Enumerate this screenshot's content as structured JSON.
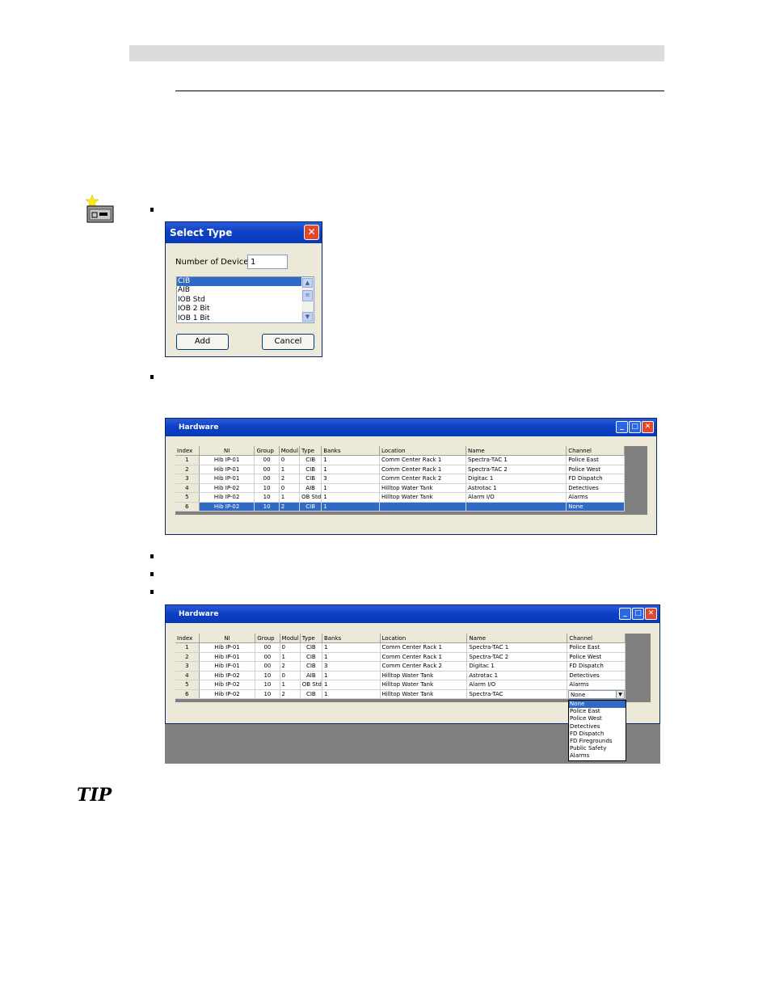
{
  "select_dialog": {
    "title": "Select Type",
    "close_glyph": "✕",
    "num_devices_label": "Number of Devices:",
    "num_devices_value": "1",
    "types": [
      "CIB",
      "AIB",
      "IOB Std",
      "IOB 2 Bit",
      "IOB 1 Bit"
    ],
    "selected_type": "CIB",
    "add_label": "Add",
    "cancel_label": "Cancel"
  },
  "hardware1": {
    "title": "Hardware",
    "columns": [
      "Index",
      "NI",
      "Group",
      "Modul",
      "Type",
      "Banks",
      "Location",
      "Name",
      "Channel"
    ],
    "rows": [
      [
        "1",
        "Hib IP-01",
        "00",
        "0",
        "CIB",
        "1",
        "Comm Center Rack 1",
        "Spectra-TAC 1",
        "Police East"
      ],
      [
        "2",
        "Hib IP-01",
        "00",
        "1",
        "CIB",
        "1",
        "Comm Center Rack 1",
        "Spectra-TAC 2",
        "Police West"
      ],
      [
        "3",
        "Hib IP-01",
        "00",
        "2",
        "CIB",
        "3",
        "Comm Center Rack 2",
        "Digitac 1",
        "FD Dispatch"
      ],
      [
        "4",
        "Hib IP-02",
        "10",
        "0",
        "AIB",
        "1",
        "Hilltop Water Tank",
        "Astrotac 1",
        "Detectives"
      ],
      [
        "5",
        "Hib IP-02",
        "10",
        "1",
        "OB Std",
        "1",
        "Hilltop Water Tank",
        "Alarm I/O",
        "Alarms"
      ],
      [
        "6",
        "Hib IP-02",
        "10",
        "2",
        "CIB",
        "1",
        "",
        "",
        "None"
      ]
    ]
  },
  "hardware2": {
    "title": "Hardware",
    "columns": [
      "Index",
      "NI",
      "Group",
      "Modul",
      "Type",
      "Banks",
      "Location",
      "Name",
      "Channel"
    ],
    "rows": [
      [
        "1",
        "Hib IP-01",
        "00",
        "0",
        "CIB",
        "1",
        "Comm Center Rack 1",
        "Spectra-TAC 1",
        "Police East"
      ],
      [
        "2",
        "Hib IP-01",
        "00",
        "1",
        "CIB",
        "1",
        "Comm Center Rack 1",
        "Spectra-TAC 2",
        "Police West"
      ],
      [
        "3",
        "Hib IP-01",
        "00",
        "2",
        "CIB",
        "3",
        "Comm Center Rack 2",
        "Digitac 1",
        "FD Dispatch"
      ],
      [
        "4",
        "Hib IP-02",
        "10",
        "0",
        "AIB",
        "1",
        "Hilltop Water Tank",
        "Astrotac 1",
        "Detectives"
      ],
      [
        "5",
        "Hib IP-02",
        "10",
        "1",
        "OB Std",
        "1",
        "Hilltop Water Tank",
        "Alarm I/O",
        "Alarms"
      ],
      [
        "6",
        "Hib IP-02",
        "10",
        "2",
        "CIB",
        "1",
        "Hilltop Water Tank",
        "Spectra-TAC",
        ""
      ]
    ],
    "channel_dropdown_value": "None",
    "channel_options": [
      "None",
      "Police East",
      "Police West",
      "Detectives",
      "FD Dispatch",
      "FD Firegrounds",
      "Public Safety",
      "Alarms"
    ]
  },
  "tip_label": "TIP"
}
